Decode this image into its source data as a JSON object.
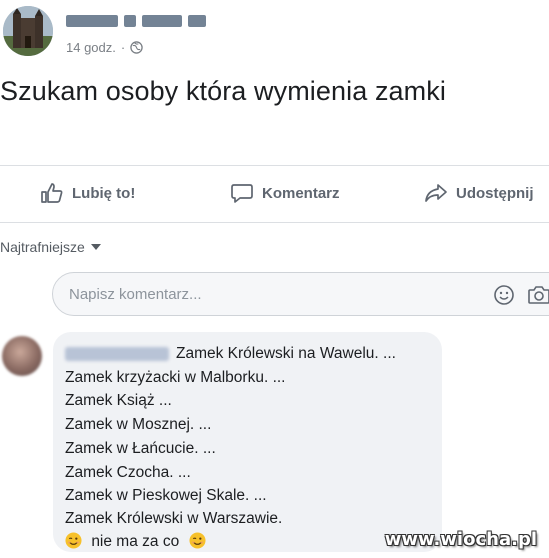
{
  "post": {
    "time": "14 godz.",
    "separator": "·",
    "text": "Szukam osoby która wymienia zamki"
  },
  "actions": {
    "like": "Lubię to!",
    "comment": "Komentarz",
    "share": "Udostępnij"
  },
  "comments_sort": "Najtrafniejsze",
  "comment_input": {
    "placeholder": "Napisz komentarz..."
  },
  "comment": {
    "lines": [
      "Zamek Królewski na Wawelu. ...",
      "Zamek krzyżacki w Malborku. ...",
      "Zamek Książ ...",
      "Zamek w Mosznej. ...",
      "Zamek w Łańcucie. ...",
      "Zamek Czocha. ...",
      "Zamek w Pieskowej Skale. ...",
      "Zamek Królewski w Warszawie.",
      "nie ma za co"
    ]
  },
  "watermark": "www.wiocha.pl",
  "colors": {
    "bubble": "#f0f2f5",
    "action_text": "#5f6670",
    "emoji": "#f7c12b"
  },
  "icons": [
    "globe-icon",
    "thumbs-up-icon",
    "comment-icon",
    "share-icon",
    "smiley-icon",
    "camera-icon",
    "winking-emoji-icon"
  ]
}
